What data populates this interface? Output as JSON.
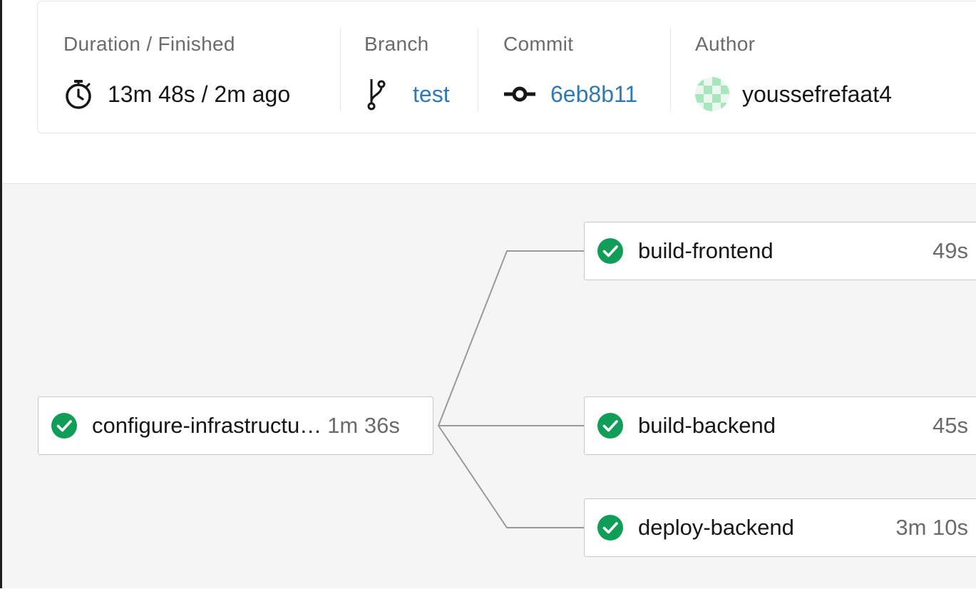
{
  "summary": {
    "duration": {
      "label": "Duration / Finished",
      "value": "13m 48s / 2m ago",
      "icon": "stopwatch-icon"
    },
    "branch": {
      "label": "Branch",
      "value": "test",
      "icon": "git-branch-icon"
    },
    "commit": {
      "label": "Commit",
      "value": "6eb8b11",
      "icon": "git-commit-icon"
    },
    "author": {
      "label": "Author",
      "value": "youssefrefaat4",
      "icon": "avatar-identicon"
    }
  },
  "workflow": {
    "jobs": [
      {
        "name": "configure-infrastructu…",
        "duration": "1m 36s",
        "status": "success"
      },
      {
        "name": "build-frontend",
        "duration": "49s",
        "status": "success"
      },
      {
        "name": "build-backend",
        "duration": "45s",
        "status": "success"
      },
      {
        "name": "deploy-backend",
        "duration": "3m 10s",
        "status": "success"
      }
    ]
  },
  "colors": {
    "success": "#0f9d58",
    "link": "#2f7ab5",
    "identicon": "#a8e6bb"
  }
}
